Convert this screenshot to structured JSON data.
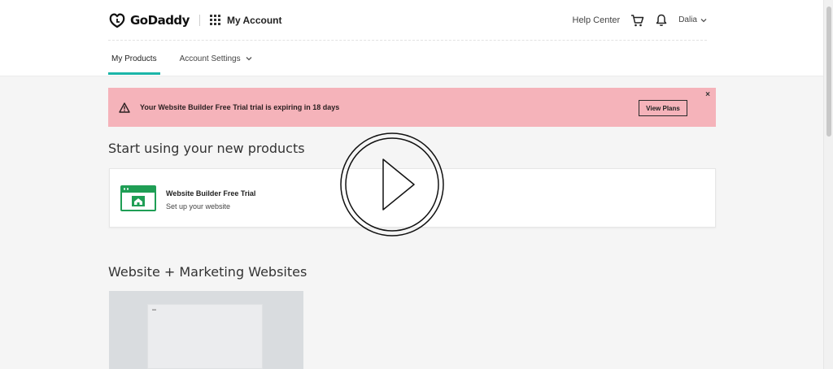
{
  "header": {
    "brand": "GoDaddy",
    "app_title": "My Account",
    "help_link": "Help Center",
    "user_name": "Dalia",
    "icons": {
      "logo": "godaddy-logo-icon",
      "apps": "apps-grid-icon",
      "cart": "cart-icon",
      "notifications": "bell-icon",
      "user_menu": "chevron-down-icon"
    }
  },
  "subnav": {
    "tabs": [
      {
        "label": "My Products",
        "active": true
      },
      {
        "label": "Account Settings",
        "active": false
      }
    ]
  },
  "alert": {
    "message": "Your Website Builder Free Trial trial is expiring in 18 days",
    "button_label": "View Plans",
    "close_glyph": "×",
    "color": "#f5b3ba"
  },
  "sections": {
    "start_title": "Start using your new products",
    "marketing_title": "Website + Marketing Websites"
  },
  "product_card": {
    "name": "Website Builder Free Trial",
    "subtitle": "Set up your website",
    "icon": "website-builder-icon"
  },
  "overlay": {
    "icon": "play-icon"
  },
  "colors": {
    "accent": "#1bb5a8",
    "product_green": "#1f9e55"
  }
}
